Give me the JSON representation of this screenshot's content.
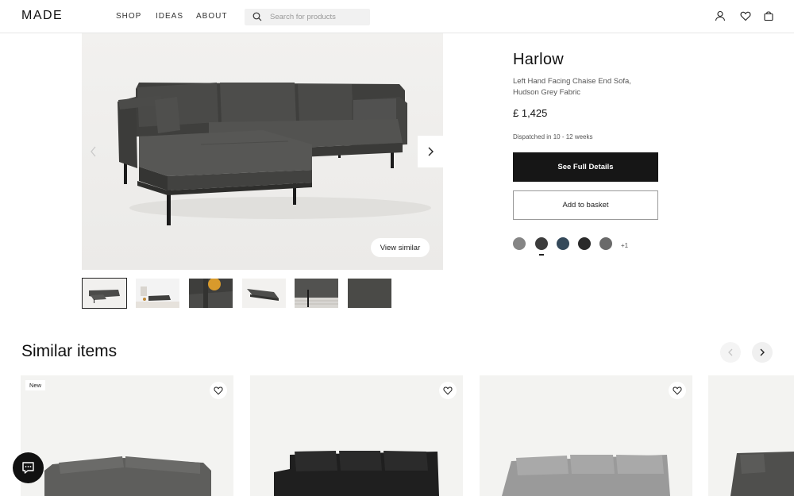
{
  "header": {
    "logo": "MADE",
    "nav": [
      "SHOP",
      "IDEAS",
      "ABOUT"
    ],
    "search_placeholder": "Search for products",
    "icons": [
      "user-icon",
      "heart-icon",
      "bag-icon"
    ]
  },
  "gallery": {
    "view_similar_label": "View similar",
    "thumbnail_count": 6,
    "selected_thumbnail": 1
  },
  "product": {
    "name": "Harlow",
    "description": "Left Hand Facing Chaise End Sofa, Hudson Grey Fabric",
    "price": "£ 1,425",
    "dispatch": "Dispatched in 10 - 12 weeks",
    "primary_cta": "See Full Details",
    "secondary_cta": "Add to basket",
    "swatches": [
      "#858585",
      "#3c3c3c",
      "#34495a",
      "#2a2a2a",
      "#6a6a6a"
    ],
    "selected_swatch": 2,
    "more_swatches": "+1"
  },
  "similar": {
    "title": "Similar items",
    "first_badge": "New"
  },
  "colors": {
    "sofa_dark": "#4a4a48",
    "primary_button": "#161616",
    "card_bg": "#f3f3f1"
  }
}
